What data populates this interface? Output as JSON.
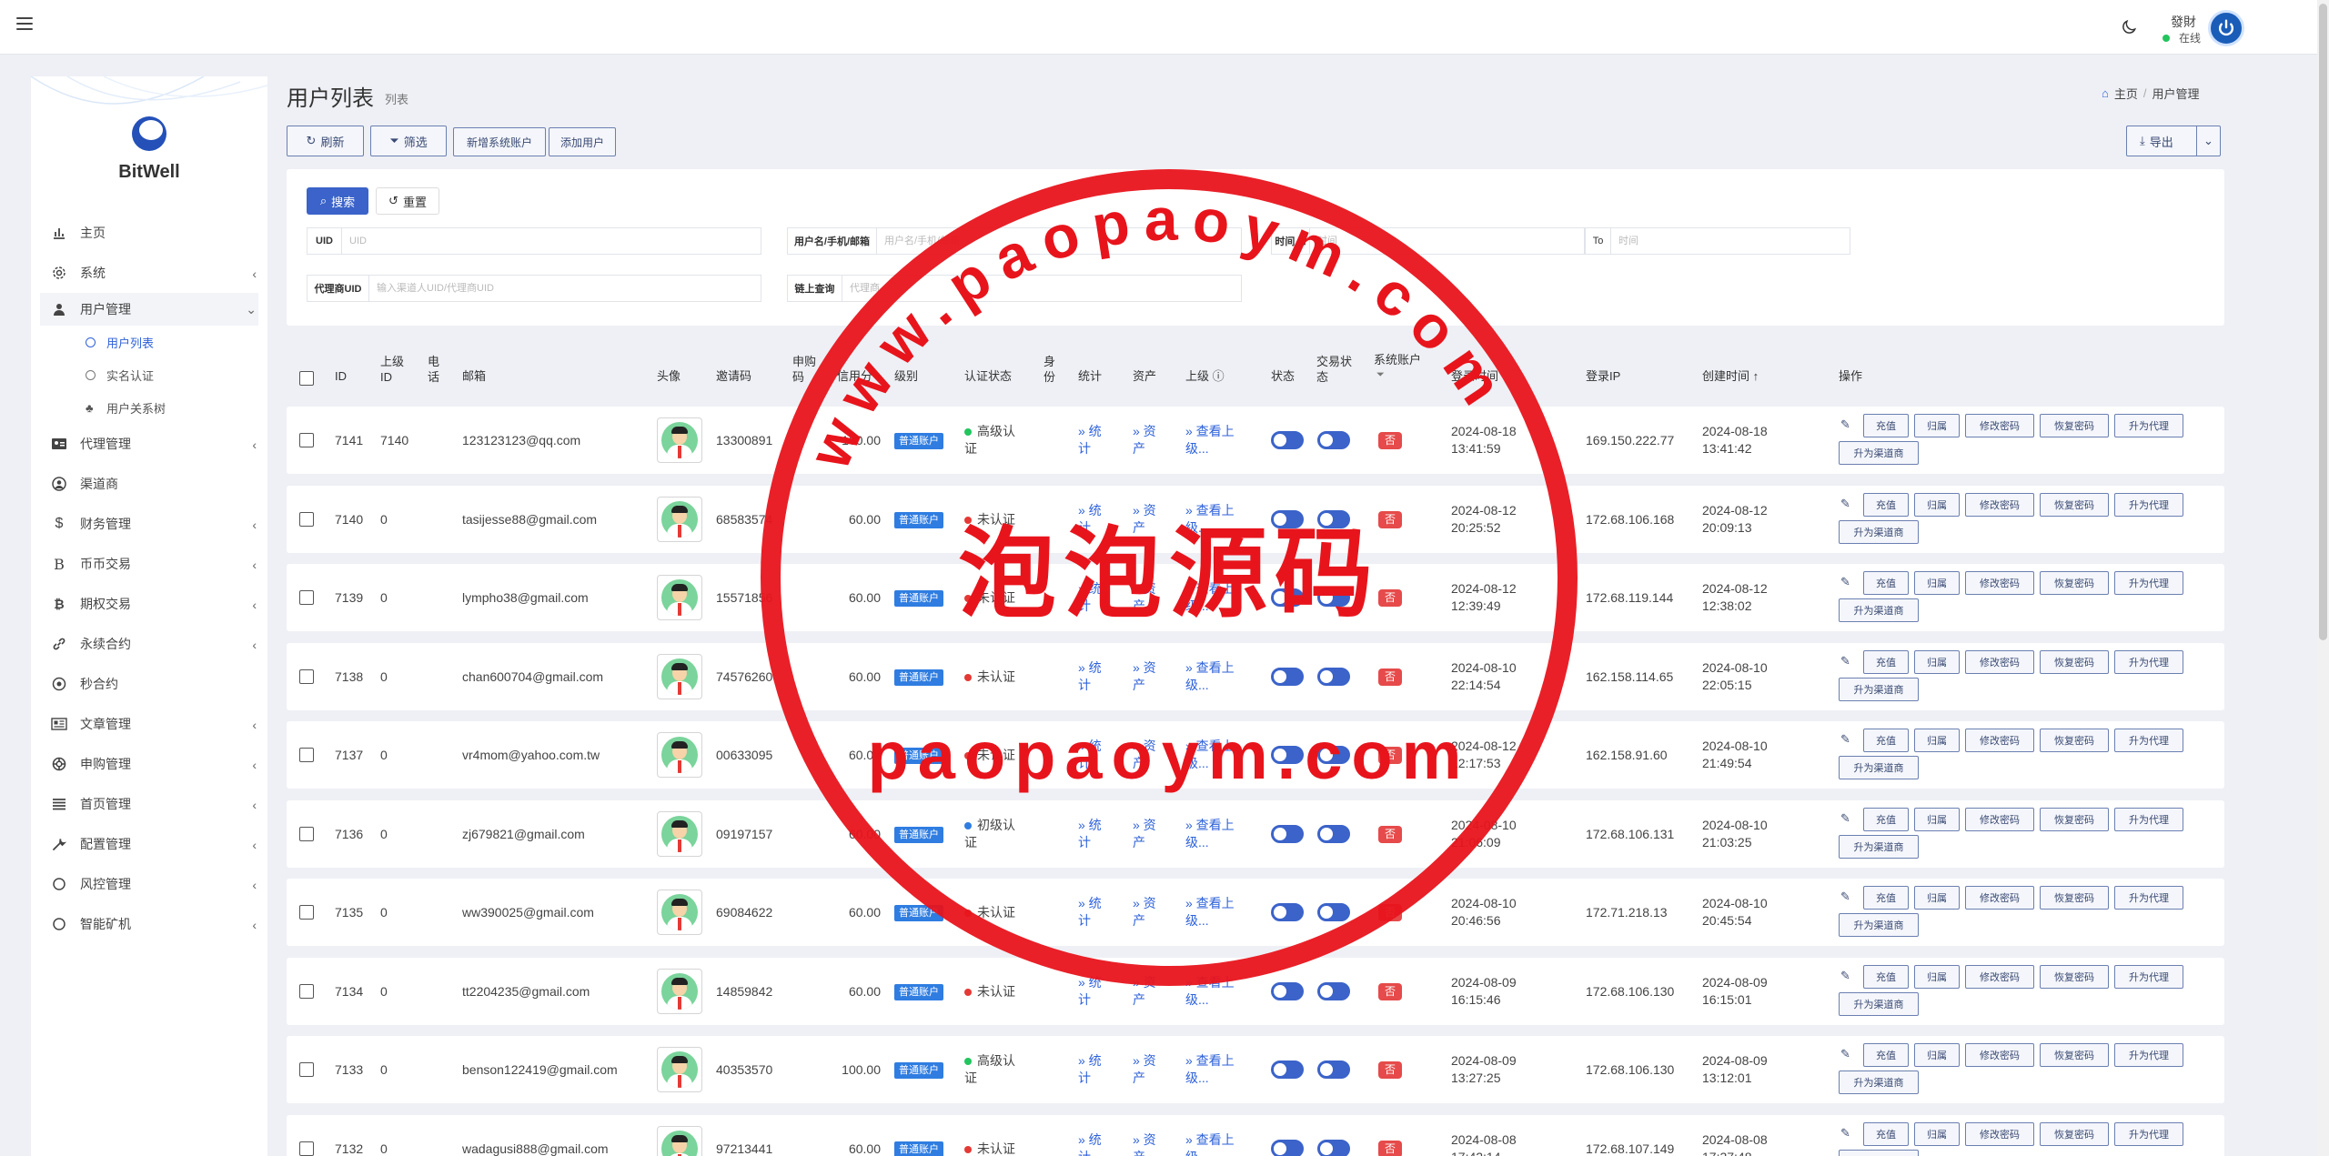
{
  "topbar": {
    "user_name": "發財",
    "user_status": "在线"
  },
  "sidebar": {
    "logo_text": "BitWell",
    "items": [
      {
        "label": "主页",
        "icon": "chart-icon"
      },
      {
        "label": "系统",
        "icon": "gear-icon"
      },
      {
        "label": "用户管理",
        "icon": "user-icon"
      },
      {
        "label": "代理管理",
        "icon": "id-card-icon"
      },
      {
        "label": "渠道商",
        "icon": "user-circle-icon"
      },
      {
        "label": "财务管理",
        "icon": "dollar-icon"
      },
      {
        "label": "币币交易",
        "icon": "bitcoin-b-icon"
      },
      {
        "label": "期权交易",
        "icon": "bitcoin-icon"
      },
      {
        "label": "永续合约",
        "icon": "link-icon"
      },
      {
        "label": "秒合约",
        "icon": "target-icon"
      },
      {
        "label": "文章管理",
        "icon": "newspaper-icon"
      },
      {
        "label": "申购管理",
        "icon": "lifebuoy-icon"
      },
      {
        "label": "首页管理",
        "icon": "list-icon"
      },
      {
        "label": "配置管理",
        "icon": "wrench-icon"
      },
      {
        "label": "风控管理",
        "icon": "circle-icon"
      },
      {
        "label": "智能矿机",
        "icon": "circle-icon"
      }
    ],
    "sub_items": [
      {
        "label": "用户列表"
      },
      {
        "label": "实名认证"
      },
      {
        "label": "用户关系树"
      }
    ]
  },
  "page": {
    "title": "用户列表",
    "subtitle": "列表"
  },
  "breadcrumb": {
    "home": "主页",
    "sep": "/",
    "current": "用户管理"
  },
  "toolbar": {
    "refresh": "刷新",
    "filter": "筛选",
    "add_system": "新增系统账户",
    "add_user": "添加用户",
    "export": "导出"
  },
  "search": {
    "search_btn": "搜索",
    "reset_btn": "重置",
    "uid_label": "UID",
    "uid_placeholder": "UID",
    "username_label": "用户名/手机/邮箱",
    "username_placeholder": "用户名/手机/邮箱",
    "time_label": "时间 ⊟",
    "time_placeholder": "时间",
    "to_label": "To",
    "to_placeholder": "时间",
    "agent_label": "代理商UID",
    "agent_placeholder": "输入渠道人UID/代理商UID",
    "chain_label": "链上查询",
    "chain_placeholder": "代理商"
  },
  "table": {
    "headers": {
      "id": "ID",
      "parent_a": "上级",
      "parent_b": "ID",
      "phone_a": "电",
      "phone_b": "话",
      "email": "邮箱",
      "avatar": "头像",
      "invite": "邀请码",
      "apply_a": "申购",
      "apply_b": "码",
      "credit": "信用分",
      "type": "级别",
      "auth": "认证状态",
      "identity_a": "身",
      "identity_b": "份",
      "stats": "统计",
      "assets": "资产",
      "superior": "上级 ⓘ",
      "status": "状态",
      "trade_a": "交易状",
      "trade_b": "态",
      "sys_a": "系统账户",
      "login_time": "登录时间",
      "login_ip": "登录IP",
      "created": "创建时间 ↑",
      "ops": "操作"
    },
    "labels": {
      "account_type": "普通账户",
      "stats_a": "» 统",
      "stats_b": "计",
      "assets_a": "» 资",
      "assets_b": "产",
      "superior_a": "» 查看上",
      "superior_b": "级...",
      "sys_no": "否",
      "recharge": "充值",
      "assign": "归属",
      "change_pwd": "修改密码",
      "restore_pwd": "恢复密码",
      "upgrade_agent": "升为代理",
      "upgrade_channel": "升为渠道商"
    },
    "rows": [
      {
        "id": "7141",
        "parent": "7140",
        "email": "123123123@qq.com",
        "invite": "13300891",
        "credit": "100.00",
        "auth_a": "高级认",
        "auth_b": "证",
        "auth_color": "#22c55e",
        "login_date": "2024-08-18",
        "login_time": "13:41:59",
        "ip": "169.150.222.77",
        "created_date": "2024-08-18",
        "created_time": "13:41:42"
      },
      {
        "id": "7140",
        "parent": "0",
        "email": "tasijesse88@gmail.com",
        "invite": "68583574",
        "credit": "60.00",
        "auth_a": "未认证",
        "auth_b": "",
        "auth_color": "#e53935",
        "login_date": "2024-08-12",
        "login_time": "20:25:52",
        "ip": "172.68.106.168",
        "created_date": "2024-08-12",
        "created_time": "20:09:13"
      },
      {
        "id": "7139",
        "parent": "0",
        "email": "lympho38@gmail.com",
        "invite": "15571856",
        "credit": "60.00",
        "auth_a": "未认证",
        "auth_b": "",
        "auth_color": "#e53935",
        "login_date": "2024-08-12",
        "login_time": "12:39:49",
        "ip": "172.68.119.144",
        "created_date": "2024-08-12",
        "created_time": "12:38:02"
      },
      {
        "id": "7138",
        "parent": "0",
        "email": "chan600704@gmail.com",
        "invite": "74576260",
        "credit": "60.00",
        "auth_a": "未认证",
        "auth_b": "",
        "auth_color": "#e53935",
        "login_date": "2024-08-10",
        "login_time": "22:14:54",
        "ip": "162.158.114.65",
        "created_date": "2024-08-10",
        "created_time": "22:05:15"
      },
      {
        "id": "7137",
        "parent": "0",
        "email": "vr4mom@yahoo.com.tw",
        "invite": "00633095",
        "credit": "60.00",
        "auth_a": "未认证",
        "auth_b": "",
        "auth_color": "#e53935",
        "login_date": "2024-08-12",
        "login_time": "12:17:53",
        "ip": "162.158.91.60",
        "created_date": "2024-08-10",
        "created_time": "21:49:54"
      },
      {
        "id": "7136",
        "parent": "0",
        "email": "zj679821@gmail.com",
        "invite": "09197157",
        "credit": "60.00",
        "auth_a": "初级认",
        "auth_b": "证",
        "auth_color": "#2f7de1",
        "login_date": "2024-08-10",
        "login_time": "21:06:09",
        "ip": "172.68.106.131",
        "created_date": "2024-08-10",
        "created_time": "21:03:25"
      },
      {
        "id": "7135",
        "parent": "0",
        "email": "ww390025@gmail.com",
        "invite": "69084622",
        "credit": "60.00",
        "auth_a": "未认证",
        "auth_b": "",
        "auth_color": "#e53935",
        "login_date": "2024-08-10",
        "login_time": "20:46:56",
        "ip": "172.71.218.13",
        "created_date": "2024-08-10",
        "created_time": "20:45:54"
      },
      {
        "id": "7134",
        "parent": "0",
        "email": "tt2204235@gmail.com",
        "invite": "14859842",
        "credit": "60.00",
        "auth_a": "未认证",
        "auth_b": "",
        "auth_color": "#e53935",
        "login_date": "2024-08-09",
        "login_time": "16:15:46",
        "ip": "172.68.106.130",
        "created_date": "2024-08-09",
        "created_time": "16:15:01"
      },
      {
        "id": "7133",
        "parent": "0",
        "email": "benson122419@gmail.com",
        "invite": "40353570",
        "credit": "100.00",
        "auth_a": "高级认",
        "auth_b": "证",
        "auth_color": "#22c55e",
        "login_date": "2024-08-09",
        "login_time": "13:27:25",
        "ip": "172.68.106.130",
        "created_date": "2024-08-09",
        "created_time": "13:12:01"
      },
      {
        "id": "7132",
        "parent": "0",
        "email": "wadagusi888@gmail.com",
        "invite": "97213441",
        "credit": "60.00",
        "auth_a": "未认证",
        "auth_b": "",
        "auth_color": "#e53935",
        "login_date": "2024-08-08",
        "login_time": "17:42:14",
        "ip": "172.68.107.149",
        "created_date": "2024-08-08",
        "created_time": "17:37:48"
      }
    ]
  },
  "watermark": {
    "top_arc": "www.paopaoym.com",
    "center": "泡泡源码",
    "bottom": "paopaoym.com",
    "color": "#e8141c"
  }
}
